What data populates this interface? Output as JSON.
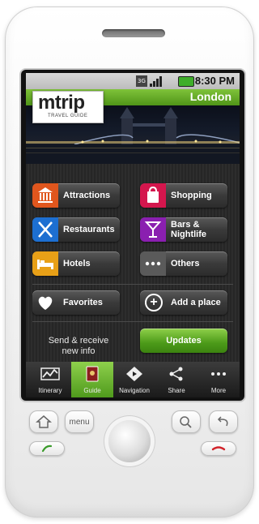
{
  "status_bar": {
    "time": "8:30 PM",
    "network_label": "3G"
  },
  "header": {
    "city": "London"
  },
  "logo": {
    "name": "mtrip",
    "tagline": "TRAVEL GUIDE"
  },
  "categories": [
    {
      "label": "Attractions",
      "icon": "museum-icon",
      "color": "#e0561d"
    },
    {
      "label": "Shopping",
      "icon": "shopping-bag-icon",
      "color": "#d4164d"
    },
    {
      "label": "Restaurants",
      "icon": "cutlery-icon",
      "color": "#1d6fd1"
    },
    {
      "label": "Bars &\nNightlife",
      "label_line1": "Bars &",
      "label_line2": "Nightlife",
      "icon": "cocktail-icon",
      "color": "#8a1fb0"
    },
    {
      "label": "Hotels",
      "icon": "bed-icon",
      "color": "#e8a017"
    },
    {
      "label": "Others",
      "icon": "more-dots-icon",
      "color": "#5a5a5a"
    }
  ],
  "actions": {
    "favorites": "Favorites",
    "add_place": "Add a place"
  },
  "updates": {
    "text": "Send & receive new info",
    "text_line1": "Send & receive",
    "text_line2": "new info",
    "button": "Updates"
  },
  "tabs": [
    {
      "label": "Itinerary",
      "icon": "itinerary-icon"
    },
    {
      "label": "Guide",
      "icon": "guide-book-icon",
      "active": true
    },
    {
      "label": "Navigation",
      "icon": "navigation-icon"
    },
    {
      "label": "Share",
      "icon": "share-icon"
    },
    {
      "label": "More",
      "icon": "more-icon"
    }
  ],
  "hardware": {
    "menu_label": "menu"
  }
}
